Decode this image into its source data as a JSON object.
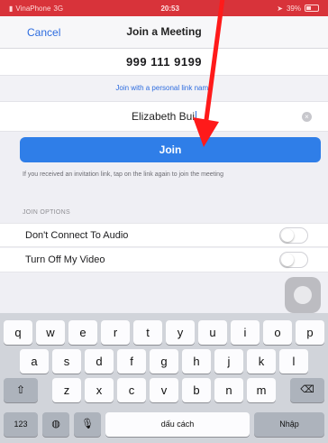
{
  "status_bar": {
    "carrier": "VinaPhone",
    "network": "3G",
    "time": "20:53",
    "battery": "39%"
  },
  "navbar": {
    "cancel_label": "Cancel",
    "title": "Join a Meeting"
  },
  "meeting_id": "999 111 9199",
  "personal_link_label": "Join with a personal link name",
  "name_field": {
    "value": "Elizabeth Bui"
  },
  "join_label": "Join",
  "hint_text": "If you received an invitation link, tap on the link again to join the meeting",
  "options": {
    "header": "JOIN OPTIONS",
    "items": [
      {
        "label": "Don't Connect To Audio",
        "on": false
      },
      {
        "label": "Turn Off My Video",
        "on": false
      }
    ]
  },
  "keyboard": {
    "row1": [
      "q",
      "w",
      "e",
      "r",
      "t",
      "y",
      "u",
      "i",
      "o",
      "p"
    ],
    "row2": [
      "a",
      "s",
      "d",
      "f",
      "g",
      "h",
      "j",
      "k",
      "l"
    ],
    "row3": [
      "z",
      "x",
      "c",
      "v",
      "b",
      "n",
      "m"
    ],
    "numbers_label": "123",
    "space_label": "dấu cách",
    "enter_label": "Nhập"
  },
  "colors": {
    "accent": "#2f7ee8",
    "status_bar": "#d8333a",
    "annotation_arrow": "#ff1a1a"
  }
}
